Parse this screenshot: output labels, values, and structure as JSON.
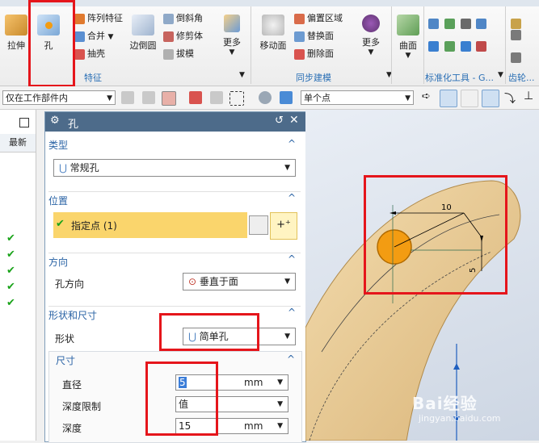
{
  "ribbon": {
    "buttons": {
      "extrude": "拉伸",
      "hole": "孔",
      "pattern_feature": "阵列特征",
      "unite": "合并",
      "shell": "抽壳",
      "edge_blend": "边倒圆",
      "chamfer": "倒斜角",
      "trim_body": "修剪体",
      "draft": "拔模",
      "more1": "更多",
      "move_face": "移动面",
      "offset_region": "偏置区域",
      "replace_face": "替换面",
      "delete_face": "删除面",
      "more2": "更多",
      "surface": "曲面"
    },
    "groups": {
      "feature": "特征",
      "sync_modeling": "同步建模",
      "std_tools": "标准化工具 - G...",
      "gear": "齿轮..."
    }
  },
  "toolbar": {
    "filter_scope": "仅在工作部件内",
    "point_mode": "单个点"
  },
  "left_column": {
    "header": "最新"
  },
  "dialog": {
    "title": "孔",
    "type_section": {
      "title": "类型",
      "value": "常规孔"
    },
    "position_section": {
      "title": "位置",
      "specify_point": "指定点 (1)"
    },
    "direction_section": {
      "title": "方向",
      "label": "孔方向",
      "value": "垂直于面"
    },
    "shape_section": {
      "title": "形状和尺寸",
      "shape_label": "形状",
      "shape_value": "简单孔",
      "dims_title": "尺寸",
      "diameter_label": "直径",
      "diameter_value": "5",
      "diameter_unit": "mm",
      "depth_limit_label": "深度限制",
      "depth_limit_value": "值",
      "depth_label": "深度",
      "depth_value": "15",
      "depth_unit": "mm"
    }
  },
  "viewport": {
    "dim_10": "10",
    "dim_5": "5"
  },
  "watermark": {
    "brand": "Bai经验",
    "url": "jingyan.baidu.com"
  },
  "colors": {
    "annotation_red": "#e5151b",
    "highlight_yellow": "#fad56c",
    "hole_orange": "#f39c12",
    "model_tan": "#e8c88d"
  }
}
